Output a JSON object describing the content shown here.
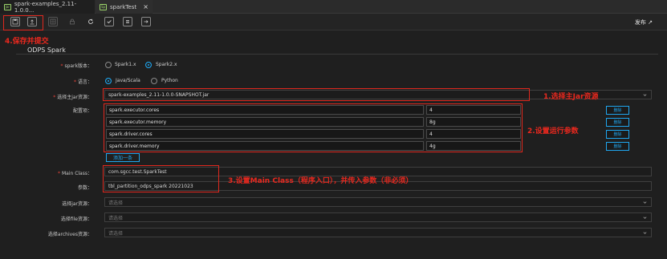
{
  "tabs": [
    {
      "label": "spark-examples_2.11-1.0.0...",
      "badge": "Jar",
      "close": "×"
    },
    {
      "label": "sparkTest",
      "badge": "Sp",
      "close": "×"
    }
  ],
  "toolbar": {
    "publish_label": "发布",
    "publish_arrow": "↗",
    "icons": [
      "save-icon",
      "submit-icon",
      "grid-icon",
      "lock-icon",
      "refresh-icon",
      "check-icon",
      "dataset-icon",
      "export-icon"
    ]
  },
  "annotations": {
    "step4": "4.保存并提交",
    "step1": "1.选择主Jar资源",
    "step2": "2.设置运行参数",
    "step3": "3.设置Main Class（程序入口），并传入参数（非必须）"
  },
  "form": {
    "section_title": "ODPS Spark",
    "spark_version": {
      "label": "spark版本：",
      "options": [
        "Spark1.x",
        "Spark2.x"
      ],
      "selected": "Spark2.x"
    },
    "language": {
      "label": "语言：",
      "options": [
        "Java/Scala",
        "Python"
      ],
      "selected": "Java/Scala"
    },
    "main_jar": {
      "label": "选择主jar资源：",
      "value": "spark-examples_2.11-1.0.0-SNAPSHOT.jar"
    },
    "config": {
      "label": "配置项：",
      "rows": [
        {
          "key": "spark.executor.cores",
          "value": "4",
          "delete": "删除"
        },
        {
          "key": "spark.executor.memory",
          "value": "8g",
          "delete": "删除"
        },
        {
          "key": "spark.driver.cores",
          "value": "4",
          "delete": "删除"
        },
        {
          "key": "spark.driver.memory",
          "value": "4g",
          "delete": "删除"
        }
      ],
      "add_label": "添加一条"
    },
    "main_class": {
      "label": "Main Class：",
      "value": "com.sgcc.test.SparkTest"
    },
    "params": {
      "label": "参数：",
      "value": "tbl_partition_odps_spark 20221023"
    },
    "jar_resource": {
      "label": "选择jar资源：",
      "placeholder": "请选择"
    },
    "file_resource": {
      "label": "选择file资源：",
      "placeholder": "请选择"
    },
    "archives_resource": {
      "label": "选择archives资源：",
      "placeholder": "请选择"
    }
  },
  "colors": {
    "accent": "#1fa6ef",
    "annotation_red": "#e0281e",
    "background": "#1f1f1f"
  }
}
